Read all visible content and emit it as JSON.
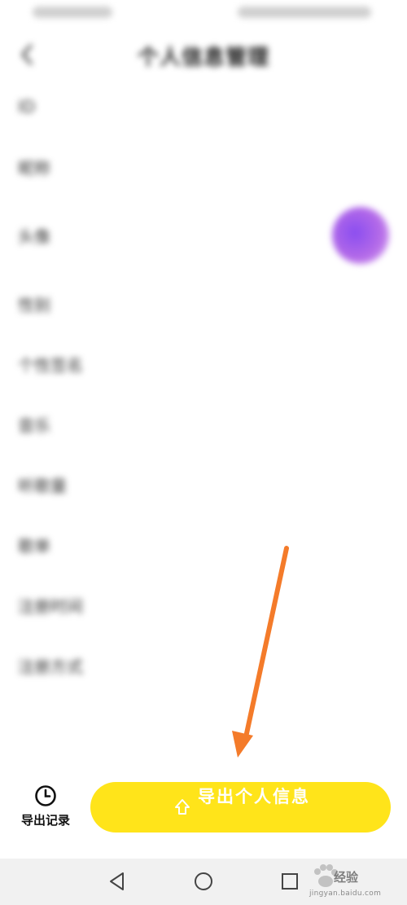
{
  "status_bar": {
    "left_text": "",
    "right_text": ""
  },
  "header": {
    "title": "个人信息管理"
  },
  "rows": [
    {
      "label": "ID",
      "value": ""
    },
    {
      "label": "昵称",
      "value": ""
    },
    {
      "label": "头像",
      "value": "",
      "type": "avatar"
    },
    {
      "label": "性别",
      "value": ""
    },
    {
      "label": "个性签名",
      "value": ""
    },
    {
      "label": "音乐",
      "value": ""
    },
    {
      "label": "听歌量",
      "value": ""
    },
    {
      "label": "歌单",
      "value": ""
    },
    {
      "label": "注册时间",
      "value": ""
    },
    {
      "label": "注册方式",
      "value": ""
    }
  ],
  "footer": {
    "export_history_label": "导出记录",
    "export_button_label": "导出个人信息"
  },
  "watermark": {
    "text": "经验",
    "url": "jingyan.baidu.com"
  },
  "colors": {
    "accent": "#ffe41a",
    "arrow": "#f47b2a",
    "avatar": "#9a5af0"
  },
  "icons": {
    "back": "chevron-left-icon",
    "clock": "clock-icon",
    "upload": "upload-arrow-icon",
    "nav_back": "triangle-back-icon",
    "nav_home": "circle-home-icon",
    "nav_recent": "square-recent-icon"
  }
}
